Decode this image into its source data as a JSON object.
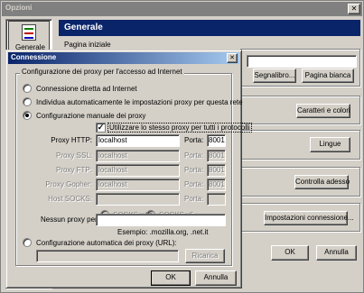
{
  "main_window": {
    "title": "Opzioni",
    "close_glyph": "✕",
    "sidebar_item": "Generale",
    "header": "Generale",
    "pagina_iniziale_label": "Pagina iniziale",
    "buttons": {
      "segnalibro": "Segnalibro...",
      "pagina_bianca": "Pagina bianca",
      "caratteri": "Caratteri e colori",
      "lingue": "Lingue",
      "controlla": "Controlla adesso",
      "impostazioni": "Impostazioni connessione...",
      "ok": "OK",
      "annulla": "Annulla"
    }
  },
  "dialog": {
    "title": "Connessione",
    "close_glyph": "✕",
    "group_label": "Configurazione dei proxy per l'accesso ad Internet",
    "radio_direct": "Connessione diretta ad Internet",
    "radio_auto_detect": "Individua automaticamente le impostazioni proxy per questa rete",
    "radio_manual": "Configurazione manuale dei proxy",
    "checkbox_same_proxy": "Utilizzare lo stesso proxy per tutti i protocolli",
    "porta_label": "Porta:",
    "proxies": [
      {
        "label": "Proxy HTTP:",
        "host": "localhost",
        "port": "8001"
      },
      {
        "label": "Proxy SSL:",
        "host": "localhost",
        "port": "8001"
      },
      {
        "label": "Proxy FTP:",
        "host": "localhost",
        "port": "8001"
      },
      {
        "label": "Proxy Gopher:",
        "host": "localhost",
        "port": "8001"
      }
    ],
    "socks_host_label": "Host SOCKS:",
    "socks_v4": "SOCKS v4",
    "socks_v5": "SOCKS v5",
    "no_proxy_label": "Nessun proxy per:",
    "no_proxy_value": "",
    "example": "Esempio: .mozilla.org, .net.it",
    "radio_auto_url": "Configurazione automatica dei proxy (URL):",
    "ricarica": "Ricarica",
    "ok": "OK",
    "annulla": "Annulla"
  }
}
